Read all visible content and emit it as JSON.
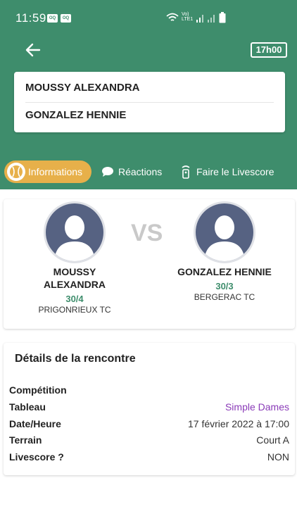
{
  "status_bar": {
    "time": "11:59",
    "badges": [
      "OQ",
      "OQ"
    ],
    "network_label": "Vo) LTE1"
  },
  "header": {
    "back_icon": "arrow-left-icon",
    "time_badge": "17h00",
    "players": [
      "MOUSSY ALEXANDRA",
      "GONZALEZ HENNIE"
    ]
  },
  "tabs": [
    {
      "label": "Informations",
      "icon": "tennis-ball-icon",
      "active": true
    },
    {
      "label": "Réactions",
      "icon": "speech-bubble-icon",
      "active": false
    },
    {
      "label": "Faire le Livescore",
      "icon": "remote-icon",
      "active": false
    }
  ],
  "match": {
    "vs": "VS",
    "player1": {
      "name_line1": "MOUSSY",
      "name_line2": "ALEXANDRA",
      "ranking": "30/4",
      "club": "PRIGONRIEUX TC"
    },
    "player2": {
      "name": "GONZALEZ HENNIE",
      "ranking": "30/3",
      "club": "BERGERAC TC"
    }
  },
  "details": {
    "title": "Détails de la rencontre",
    "rows": [
      {
        "label": "Compétition",
        "value": ""
      },
      {
        "label": "Tableau",
        "value": "Simple Dames"
      },
      {
        "label": "Date/Heure",
        "value": "17 février 2022 à 17:00"
      },
      {
        "label": "Terrain",
        "value": "Court A"
      },
      {
        "label": "Livescore ?",
        "value": "NON"
      }
    ]
  },
  "colors": {
    "header_green": "#3e8d6c",
    "active_tab": "#e7b04a",
    "avatar_bg": "#566282",
    "link_purple": "#8a3bb8"
  }
}
